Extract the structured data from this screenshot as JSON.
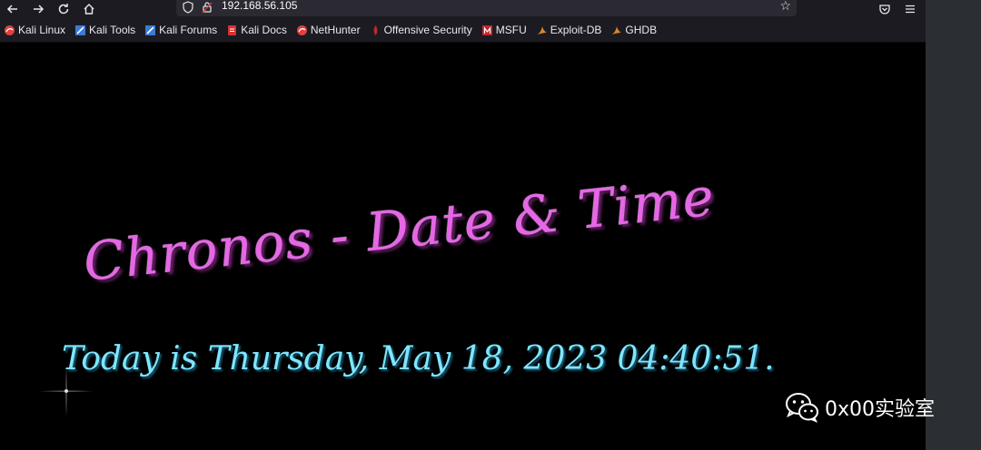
{
  "browser": {
    "url": "192.168.56.105",
    "bookmarks": [
      {
        "label": "Kali Linux",
        "icon": "kali-dragon-icon",
        "color": "#e04040"
      },
      {
        "label": "Kali Tools",
        "icon": "kali-tools-icon",
        "color": "#3a7bd5"
      },
      {
        "label": "Kali Forums",
        "icon": "kali-forums-icon",
        "color": "#3a7bd5"
      },
      {
        "label": "Kali Docs",
        "icon": "kali-docs-icon",
        "color": "#d63232"
      },
      {
        "label": "NetHunter",
        "icon": "nethunter-icon",
        "color": "#e04040"
      },
      {
        "label": "Offensive Security",
        "icon": "offsec-icon",
        "color": "#c0262e"
      },
      {
        "label": "MSFU",
        "icon": "msfu-icon",
        "color": "#c0262e"
      },
      {
        "label": "Exploit-DB",
        "icon": "exploit-db-icon",
        "color": "#d88a2c"
      },
      {
        "label": "GHDB",
        "icon": "ghdb-icon",
        "color": "#d88a2c"
      }
    ]
  },
  "page": {
    "title": "Chronos - Date & Time",
    "date_line": "Today is Thursday, May 18, 2023 04:40:51.",
    "title_color": "#e667e6",
    "date_color": "#7ee6ff"
  },
  "watermark": {
    "text": "0x00实验室",
    "icon": "wechat-icon"
  }
}
